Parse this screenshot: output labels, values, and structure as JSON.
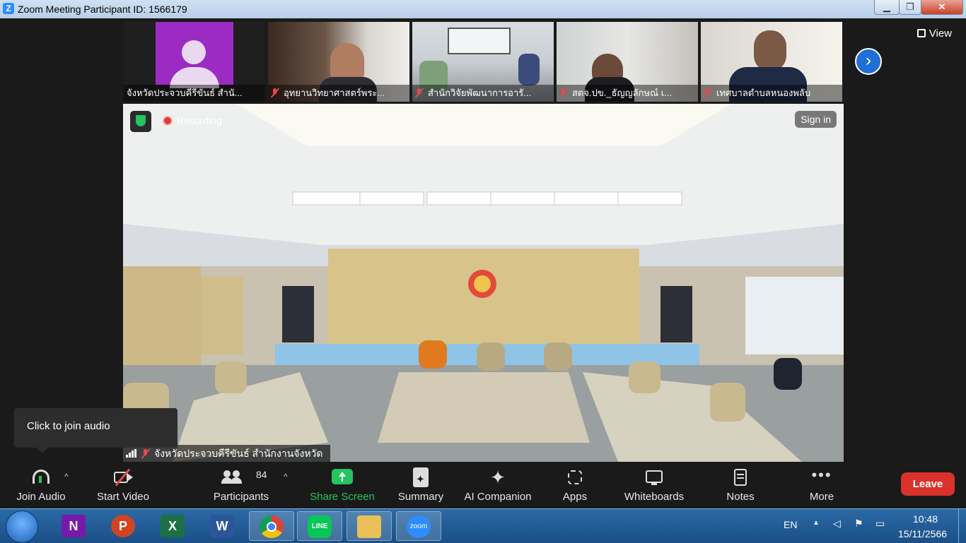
{
  "window": {
    "title": "Zoom Meeting Participant ID: 1566179",
    "app_icon_letter": "Z",
    "minimize": "▁",
    "restore": "❐",
    "close": "✕"
  },
  "thumbnails": [
    {
      "name": "จังหวัดประจวบคีรีขันธ์ สำนั...",
      "muted": false
    },
    {
      "name": "อุทยานวิทยาศาสตร์พระ...",
      "muted": true
    },
    {
      "name": "สำนักวิจัยพัฒนาการอารั...",
      "muted": true
    },
    {
      "name": "สตจ.ปข._ธัญญลักษณ์ เ...",
      "muted": true
    },
    {
      "name": "เทศบาลตำบลหนองพลับ",
      "muted": true
    }
  ],
  "view_label": "View",
  "next_arrow": "›",
  "main_video": {
    "recording_label": "Recording",
    "signin_label": "Sign in",
    "speaker_name": "จังหวัดประจวบคีรีขันธ์ สำนักงานจังหวัด"
  },
  "tooltip": "Click to join audio",
  "toolbar": {
    "join_audio": "Join Audio",
    "start_video": "Start Video",
    "participants": "Participants",
    "participants_count": "84",
    "share_screen": "Share Screen",
    "summary": "Summary",
    "ai_companion": "AI Companion",
    "apps": "Apps",
    "whiteboards": "Whiteboards",
    "notes": "Notes",
    "more": "More",
    "leave": "Leave",
    "caret": "^"
  },
  "taskbar": {
    "apps": [
      {
        "name": "onenote",
        "letter": "N",
        "color": "#7719aa"
      },
      {
        "name": "powerpoint",
        "letter": "P",
        "color": "#d04423"
      },
      {
        "name": "excel",
        "letter": "X",
        "color": "#1d7044"
      },
      {
        "name": "word",
        "letter": "W",
        "color": "#2b579a"
      },
      {
        "name": "chrome",
        "letter": "",
        "color": "#e8e8e8"
      },
      {
        "name": "line",
        "letter": "LINE",
        "color": "#06c755"
      },
      {
        "name": "explorer",
        "letter": "",
        "color": "#e8c15a"
      },
      {
        "name": "zoom",
        "letter": "zoom",
        "color": "#2d8cff"
      }
    ],
    "language": "EN",
    "time": "10:48",
    "date": "15/11/2566"
  }
}
